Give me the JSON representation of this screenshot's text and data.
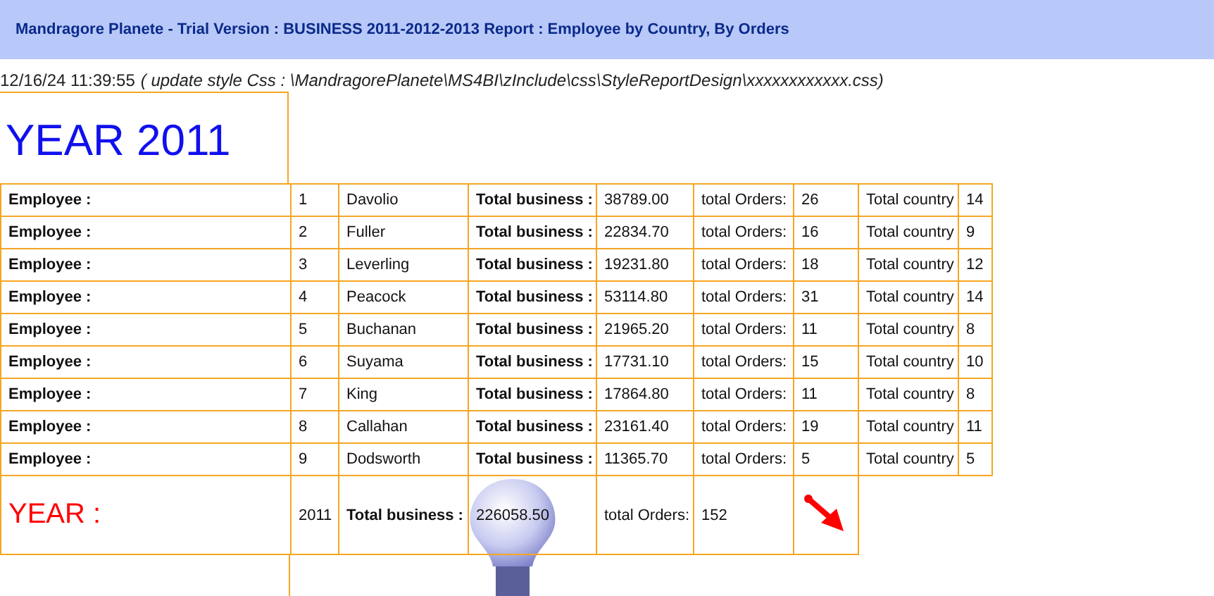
{
  "header": {
    "title": "Mandragore Planete - Trial Version : BUSINESS 2011-2012-2013 Report : Employee by Country, By Orders"
  },
  "timestamp": "12/16/24 11:39:55",
  "style_note": "( update style Css : \\MandragorePlanete\\MS4BI\\zInclude\\css\\StyleReportDesign\\xxxxxxxxxxxx.css)",
  "year_title": "YEAR 2011",
  "rows": [
    {
      "label": "Employee :",
      "number": "1",
      "name": "Davolio",
      "business_label": "Total business :",
      "business": "38789.00",
      "orders_label": "total Orders:",
      "orders": "26",
      "country_label": "Total country",
      "country": "14"
    },
    {
      "label": "Employee :",
      "number": "2",
      "name": "Fuller",
      "business_label": "Total business :",
      "business": "22834.70",
      "orders_label": "total Orders:",
      "orders": "16",
      "country_label": "Total country",
      "country": "9"
    },
    {
      "label": "Employee :",
      "number": "3",
      "name": "Leverling",
      "business_label": "Total business :",
      "business": "19231.80",
      "orders_label": "total Orders:",
      "orders": "18",
      "country_label": "Total country",
      "country": "12"
    },
    {
      "label": "Employee :",
      "number": "4",
      "name": "Peacock",
      "business_label": "Total business :",
      "business": "53114.80",
      "orders_label": "total Orders:",
      "orders": "31",
      "country_label": "Total country",
      "country": "14"
    },
    {
      "label": "Employee :",
      "number": "5",
      "name": "Buchanan",
      "business_label": "Total business :",
      "business": "21965.20",
      "orders_label": "total Orders:",
      "orders": "11",
      "country_label": "Total country",
      "country": "8"
    },
    {
      "label": "Employee :",
      "number": "6",
      "name": "Suyama",
      "business_label": "Total business :",
      "business": "17731.10",
      "orders_label": "total Orders:",
      "orders": "15",
      "country_label": "Total country",
      "country": "10"
    },
    {
      "label": "Employee :",
      "number": "7",
      "name": "King",
      "business_label": "Total business :",
      "business": "17864.80",
      "orders_label": "total Orders:",
      "orders": "11",
      "country_label": "Total country",
      "country": "8"
    },
    {
      "label": "Employee :",
      "number": "8",
      "name": "Callahan",
      "business_label": "Total business :",
      "business": "23161.40",
      "orders_label": "total Orders:",
      "orders": "19",
      "country_label": "Total country",
      "country": "11"
    },
    {
      "label": "Employee :",
      "number": "9",
      "name": "Dodsworth",
      "business_label": "Total business :",
      "business": "11365.70",
      "orders_label": "total Orders:",
      "orders": "5",
      "country_label": "Total country",
      "country": "5"
    }
  ],
  "total": {
    "label": "YEAR :",
    "year": "2011",
    "business_label": "Total business :",
    "business": "226058.50",
    "orders_label": "total Orders:",
    "orders": "152"
  }
}
